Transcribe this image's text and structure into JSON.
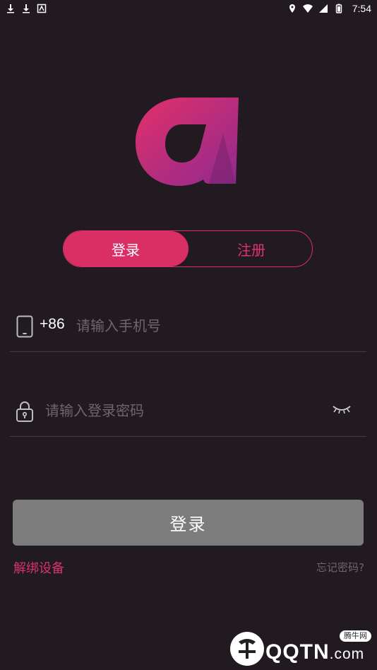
{
  "status_bar": {
    "time": "7:54",
    "left_icons": [
      "download-icon",
      "download-icon",
      "app-notification-icon"
    ],
    "right_icons": [
      "location-icon",
      "wifi-icon",
      "signal-icon",
      "battery-icon"
    ]
  },
  "tabs": {
    "login_label": "登录",
    "register_label": "注册"
  },
  "phone_field": {
    "country_code": "+86",
    "placeholder": "请输入手机号",
    "icon": "phone-icon"
  },
  "password_field": {
    "placeholder": "请输入登录密码",
    "icon": "lock-icon",
    "toggle_icon": "eye-closed-icon"
  },
  "login_button_label": "登录",
  "unbind_device_label": "解绑设备",
  "forgot_password_label": "忘记密码?",
  "watermark": {
    "brand": "QQTN",
    "suffix": ".com",
    "tag": "腾牛网"
  },
  "colors": {
    "background": "#211a20",
    "accent": "#d92e66",
    "button_disabled": "#7c7c7c",
    "placeholder": "#6e666c"
  }
}
